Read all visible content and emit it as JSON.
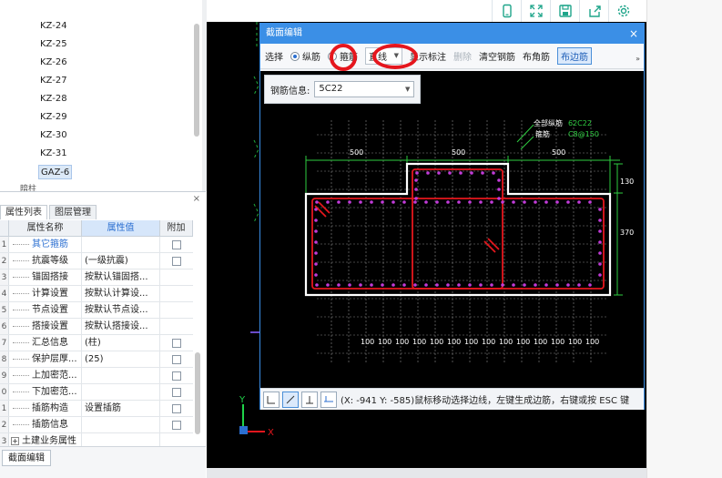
{
  "tree": {
    "items": [
      "KZ-24",
      "KZ-25",
      "KZ-26",
      "KZ-27",
      "KZ-28",
      "KZ-29",
      "KZ-30",
      "KZ-31",
      "GAZ-6"
    ],
    "selected_index": 8,
    "partial_label": "暗柱"
  },
  "props": {
    "tabs": [
      "属性列表",
      "图层管理"
    ],
    "headers": {
      "name": "属性名称",
      "value": "属性值",
      "add": "附加"
    },
    "rows": [
      {
        "num": "1",
        "name": "其它箍筋",
        "value": "",
        "has_check": true,
        "blue": true,
        "indent": false
      },
      {
        "num": "2",
        "name": "抗震等级",
        "value": "(一级抗震)",
        "has_check": true,
        "blue": false,
        "indent": true
      },
      {
        "num": "3",
        "name": "锚固搭接",
        "value": "按默认锚固搭...",
        "has_check": false,
        "blue": false,
        "indent": true
      },
      {
        "num": "4",
        "name": "计算设置",
        "value": "按默认计算设...",
        "has_check": false,
        "blue": false,
        "indent": true
      },
      {
        "num": "5",
        "name": "节点设置",
        "value": "按默认节点设...",
        "has_check": false,
        "blue": false,
        "indent": true
      },
      {
        "num": "6",
        "name": "搭接设置",
        "value": "按默认搭接设...",
        "has_check": false,
        "blue": false,
        "indent": true
      },
      {
        "num": "7",
        "name": "汇总信息",
        "value": "(柱)",
        "has_check": true,
        "blue": false,
        "indent": true
      },
      {
        "num": "8",
        "name": "保护层厚...",
        "value": "(25)",
        "has_check": true,
        "blue": false,
        "indent": true
      },
      {
        "num": "9",
        "name": "上加密范...",
        "value": "",
        "has_check": true,
        "blue": false,
        "indent": true
      },
      {
        "num": "0",
        "name": "下加密范...",
        "value": "",
        "has_check": true,
        "blue": false,
        "indent": true
      },
      {
        "num": "1",
        "name": "插筋构造",
        "value": "设置插筋",
        "has_check": true,
        "blue": false,
        "indent": true
      },
      {
        "num": "2",
        "name": "插筋信息",
        "value": "",
        "has_check": true,
        "blue": false,
        "indent": true
      },
      {
        "num": "3",
        "name": "土建业务属性",
        "value": "",
        "has_check": false,
        "blue": false,
        "indent": false,
        "expand": "+"
      }
    ]
  },
  "bottom_tab": "截面编辑",
  "dialog": {
    "title": "截面编辑",
    "close": "×",
    "toolbar": {
      "select": "选择",
      "longitudinal": "纵筋",
      "stirrup": "箍筋",
      "line_mode": "直线",
      "show_label": "显示标注",
      "delete": "删除",
      "clear": "清空钢筋",
      "corner": "布角筋",
      "edge": "布边筋",
      "more": "»"
    },
    "rebar_info": {
      "label": "钢筋信息:",
      "value": "5C22"
    },
    "annotations": {
      "all_long": "全部纵筋",
      "all_long_val": "62C22",
      "stirrup": "箍筋",
      "stirrup_val": "C8@150",
      "dim_top": [
        "500",
        "500",
        "500"
      ],
      "dim_right": [
        "130",
        "370"
      ],
      "dim_bottom": "100"
    },
    "status": "(X: -941 Y: -585)鼠标移动选择边线，左键生成边筋，右键或按 ESC 键"
  },
  "axis": {
    "y": "Y",
    "x": "X"
  },
  "colors": {
    "accent": "#3b8fe6",
    "rebar": "#e5161d",
    "dim": "#2ecc40",
    "outline": "#ffffff",
    "highlight": "#e5161d"
  }
}
